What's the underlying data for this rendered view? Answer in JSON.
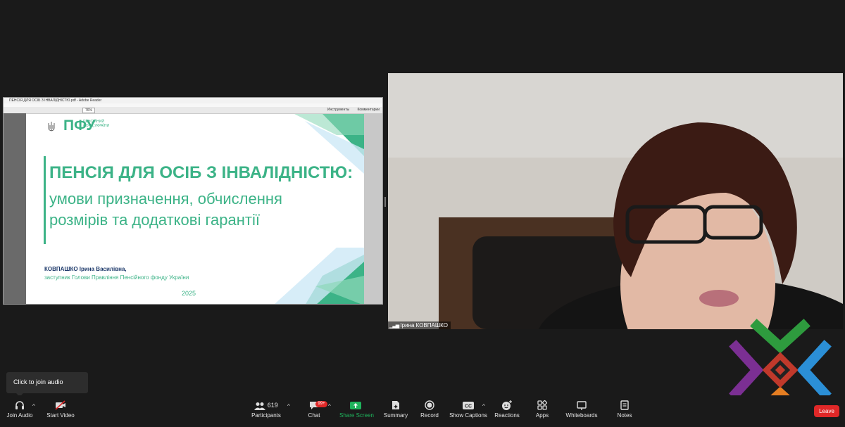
{
  "shared_screen": {
    "window_title": "ПЕНСІЯ ДЛЯ ОСІБ З ІНВАЛІДНІСТЮ.pdf - Adobe Reader",
    "toolbar_zoom": "76%",
    "toolbar_tools": "Инструменты",
    "toolbar_comment": "Комментарии",
    "slide": {
      "logo": "ПФУ",
      "logo_subtitle": "ПЕНСІЙНИЙ ФОНД УКРАЇНИ",
      "title_line1": "ПЕНСІЯ ДЛЯ ОСІБ З ІНВАЛІДНІСТЮ:",
      "title_line2": "умови призначення, обчислення",
      "title_line3": "розмірів та додаткові гарантії",
      "author_name": "КОВПАШКО Ірина Василівна,",
      "author_role": "заступник Голови Правління Пенсійного фонду України",
      "year": "2025"
    }
  },
  "video": {
    "participant_name": "Ірина КОВПАШКО"
  },
  "tooltip": {
    "text": "Click to join audio"
  },
  "toolbar": {
    "join_audio": "Join Audio",
    "start_video": "Start Video",
    "participants": "Participants",
    "participants_count": "619",
    "chat": "Chat",
    "chat_badge": "99+",
    "share_screen": "Share Screen",
    "summary": "Summary",
    "record": "Record",
    "show_captions": "Show Captions",
    "reactions": "Reactions",
    "apps": "Apps",
    "whiteboards": "Whiteboards",
    "notes": "Notes",
    "leave": "Leave"
  },
  "colors": {
    "slide_green": "#3cb387",
    "leave_red": "#e02828",
    "share_green": "#1fb35c"
  }
}
